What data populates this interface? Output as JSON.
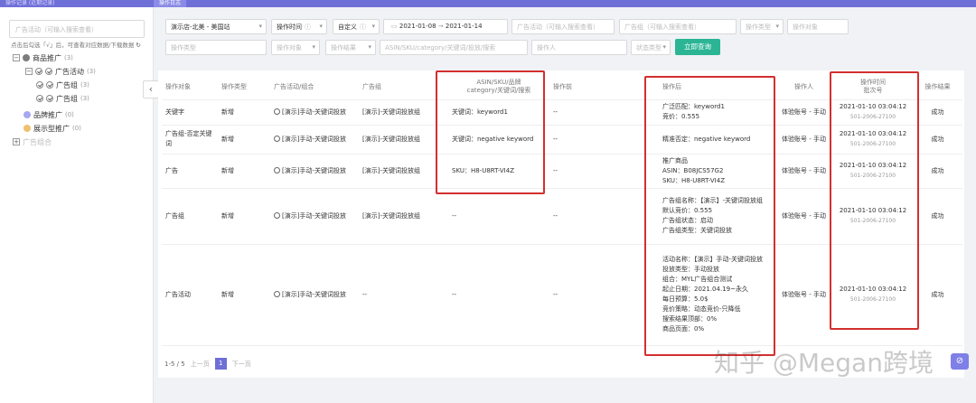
{
  "topbar": {
    "tabs": [
      "操作日志",
      "操作记录 (近期记录)"
    ],
    "active": "操作日志"
  },
  "sidebar": {
    "search_placeholder": "广告活动（可输入搜索查看）",
    "hint": "点击后勾选「√」后，可查看对应数据/下载数据",
    "tree": [
      {
        "label": "商品推广",
        "count": "(3)"
      },
      {
        "label": "广告活动",
        "count": "(3)"
      },
      {
        "label": "广告组",
        "count": "(3)"
      },
      {
        "label": "广告组",
        "count": "(3)"
      },
      {
        "label": "品牌推广",
        "count": "(0)"
      },
      {
        "label": "展示型推广",
        "count": "(0)"
      },
      {
        "label": "广告组合",
        "count": ""
      }
    ]
  },
  "filters": {
    "shop": "演示店-北美 - 美国站",
    "time_type": "操作时间",
    "range_type": "自定义",
    "date_start": "2021-01-08",
    "date_end": "2021-01-14",
    "campaign_ph": "广告活动（可输入搜索查看）",
    "adgroup_ph": "广告组（可输入搜索查看）",
    "op_type_ph": "操作类型",
    "op_object_ph": "操作对象",
    "op_module_ph": "操作类型",
    "op_target_ph": "操作对象",
    "op_result_ph": "操作结果",
    "keyword_ph": "ASIN/SKU/category/关键词/投放/搜索",
    "operator_ph": "操作人",
    "status_ph": "状态类型",
    "query_btn": "立即查询"
  },
  "table": {
    "headers": [
      "操作对象",
      "操作类型",
      "广告活动/组合",
      "广告组",
      "ASIN/SKU/品牌\ncategory/关键词/搜索",
      "操作前",
      "操作后",
      "操作人",
      "操作时间\n批次号",
      "操作结果"
    ],
    "rows": [
      {
        "obj": "关键字",
        "type": "新增",
        "campaign": "[演示]手动-关键词投放",
        "group": "[演示]-关键词投放组",
        "asin": "关键词：keyword1",
        "before": "--",
        "after": [
          "广泛匹配：keyword1",
          "竞价：0.555"
        ],
        "user": "体验账号 - 手动",
        "time": "2021-01-10 03:04:12",
        "batch": "501-2006-27100",
        "result": "成功"
      },
      {
        "obj": "广告组-否定关键词",
        "type": "新增",
        "campaign": "[演示]手动-关键词投放",
        "group": "[演示]-关键词投放组",
        "asin": "关键词：negative keyword",
        "before": "--",
        "after": [
          "精准否定：negative keyword"
        ],
        "user": "体验账号 - 手动",
        "time": "2021-01-10 03:04:12",
        "batch": "501-2006-27100",
        "result": "成功"
      },
      {
        "obj": "广告",
        "type": "新增",
        "campaign": "[演示]手动-关键词投放",
        "group": "[演示]-关键词投放组",
        "asin": "SKU：H8-U8RT-VI4Z",
        "before": "--",
        "after": [
          "推广商品",
          "ASIN：B08JCS57G2",
          "SKU：H8-U8RT-VI4Z"
        ],
        "user": "体验账号 - 手动",
        "time": "2021-01-10 03:04:12",
        "batch": "501-2006-27100",
        "result": "成功"
      },
      {
        "obj": "广告组",
        "type": "新增",
        "campaign": "[演示]手动-关键词投放",
        "group": "[演示]-关键词投放组",
        "asin": "--",
        "before": "--",
        "after": [
          "广告组名称：【演示】-关键词投放组",
          "默认竞价：0.555",
          "广告组状态：启动",
          "广告组类型：关键词投放"
        ],
        "user": "体验账号 - 手动",
        "time": "2021-01-10 03:04:12",
        "batch": "501-2006-27100",
        "result": "成功"
      },
      {
        "obj": "广告活动",
        "type": "新增",
        "campaign": "[演示]手动-关键词投放",
        "group": "--",
        "asin": "--",
        "before": "--",
        "after": [
          "活动名称：【演示】手动-关键词投放",
          "投放类型：手动投放",
          "组合：MYL广告组合测试",
          "起止日期：2021.04.19~永久",
          "每日预算：5.0$",
          "竞价策略：动态竞价-只降低",
          "搜索结果顶部：0%",
          "商品页面：0%"
        ],
        "user": "体验账号 - 手动",
        "time": "2021-01-10 03:04:12",
        "batch": "501-2006-27100",
        "result": "成功"
      }
    ]
  },
  "pager": {
    "summary": "1-5 / 5",
    "prev": "上一页",
    "page": "1",
    "next": "下一页"
  },
  "watermark": "知乎 @Megan跨境"
}
